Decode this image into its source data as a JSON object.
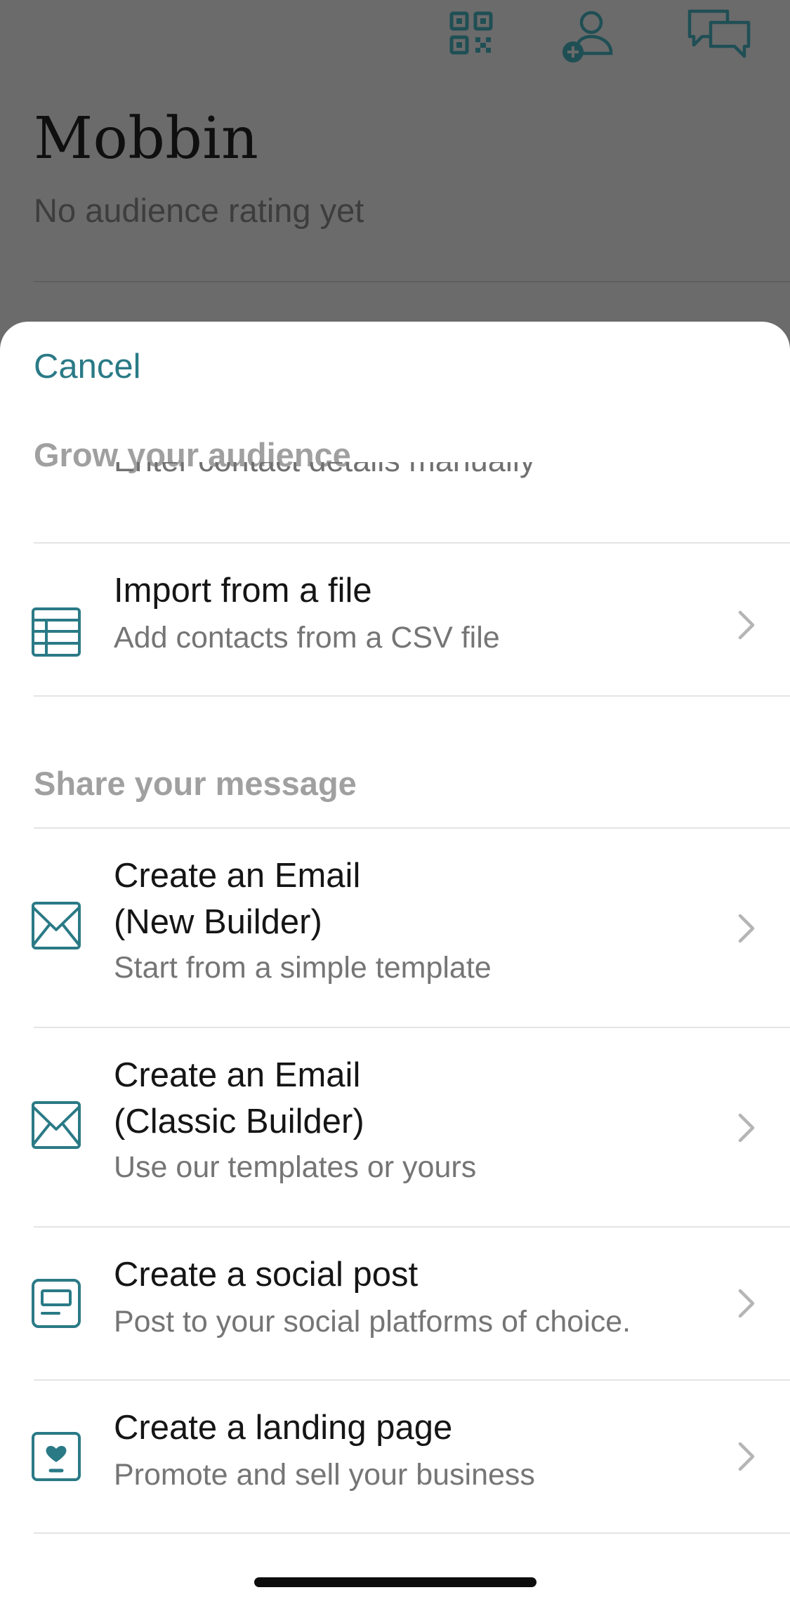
{
  "background": {
    "title": "Mobbin",
    "subtitle": "No audience rating yet",
    "icons": [
      "qr-code-icon",
      "add-contact-icon",
      "chat-icon"
    ]
  },
  "sheet": {
    "cancel_label": "Cancel",
    "sections": [
      {
        "header": "Grow your audience",
        "clipped_item_subtitle": "Enter contact details manually",
        "items": [
          {
            "icon": "table-icon",
            "title_lines": [
              "Import from a file"
            ],
            "subtitle": "Add contacts from a CSV file"
          }
        ]
      },
      {
        "header": "Share your message",
        "items": [
          {
            "icon": "envelope-icon",
            "title_lines": [
              "Create an Email",
              "(New Builder)"
            ],
            "subtitle": "Start from a simple template"
          },
          {
            "icon": "envelope-icon",
            "title_lines": [
              "Create an Email",
              "(Classic Builder)"
            ],
            "subtitle": "Use our templates or yours"
          },
          {
            "icon": "social-post-icon",
            "title_lines": [
              "Create a social post"
            ],
            "subtitle": "Post to your social platforms of choice."
          },
          {
            "icon": "landing-page-icon",
            "title_lines": [
              "Create a landing page"
            ],
            "subtitle": "Promote and sell your business"
          }
        ]
      }
    ]
  },
  "colors": {
    "accent": "#2a7a86",
    "overlay": "#6b6b6b",
    "section_header": "#a0a0a0",
    "subtitle": "#757575"
  }
}
